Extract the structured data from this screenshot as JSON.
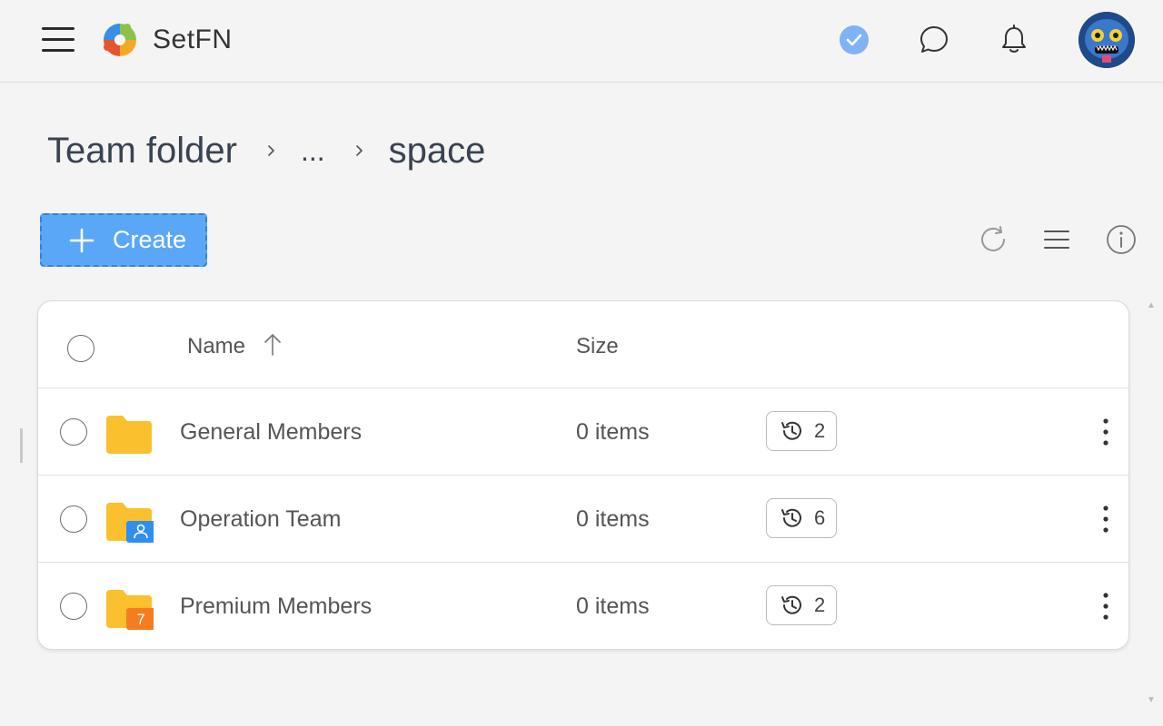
{
  "app": {
    "brand": "SetFN"
  },
  "header": {
    "icons": [
      "menu-icon",
      "status-check-icon",
      "chat-icon",
      "bell-icon",
      "avatar"
    ]
  },
  "breadcrumb": {
    "root": "Team folder",
    "ellipsis": "...",
    "current": "space"
  },
  "toolbar": {
    "create_label": "Create"
  },
  "table": {
    "columns": {
      "name": "Name",
      "size": "Size"
    },
    "rows": [
      {
        "name": "General Members",
        "size": "0 items",
        "versions": "2",
        "folder_badge": "",
        "badge_type": "none"
      },
      {
        "name": "Operation Team",
        "size": "0 items",
        "versions": "6",
        "folder_badge": "",
        "badge_type": "user"
      },
      {
        "name": "Premium Members",
        "size": "0 items",
        "versions": "2",
        "folder_badge": "7",
        "badge_type": "number"
      }
    ]
  },
  "colors": {
    "accent": "#5ba7f7",
    "folder": "#fbc02d",
    "user_badge": "#2f8ff0",
    "number_badge": "#f57c1f"
  }
}
